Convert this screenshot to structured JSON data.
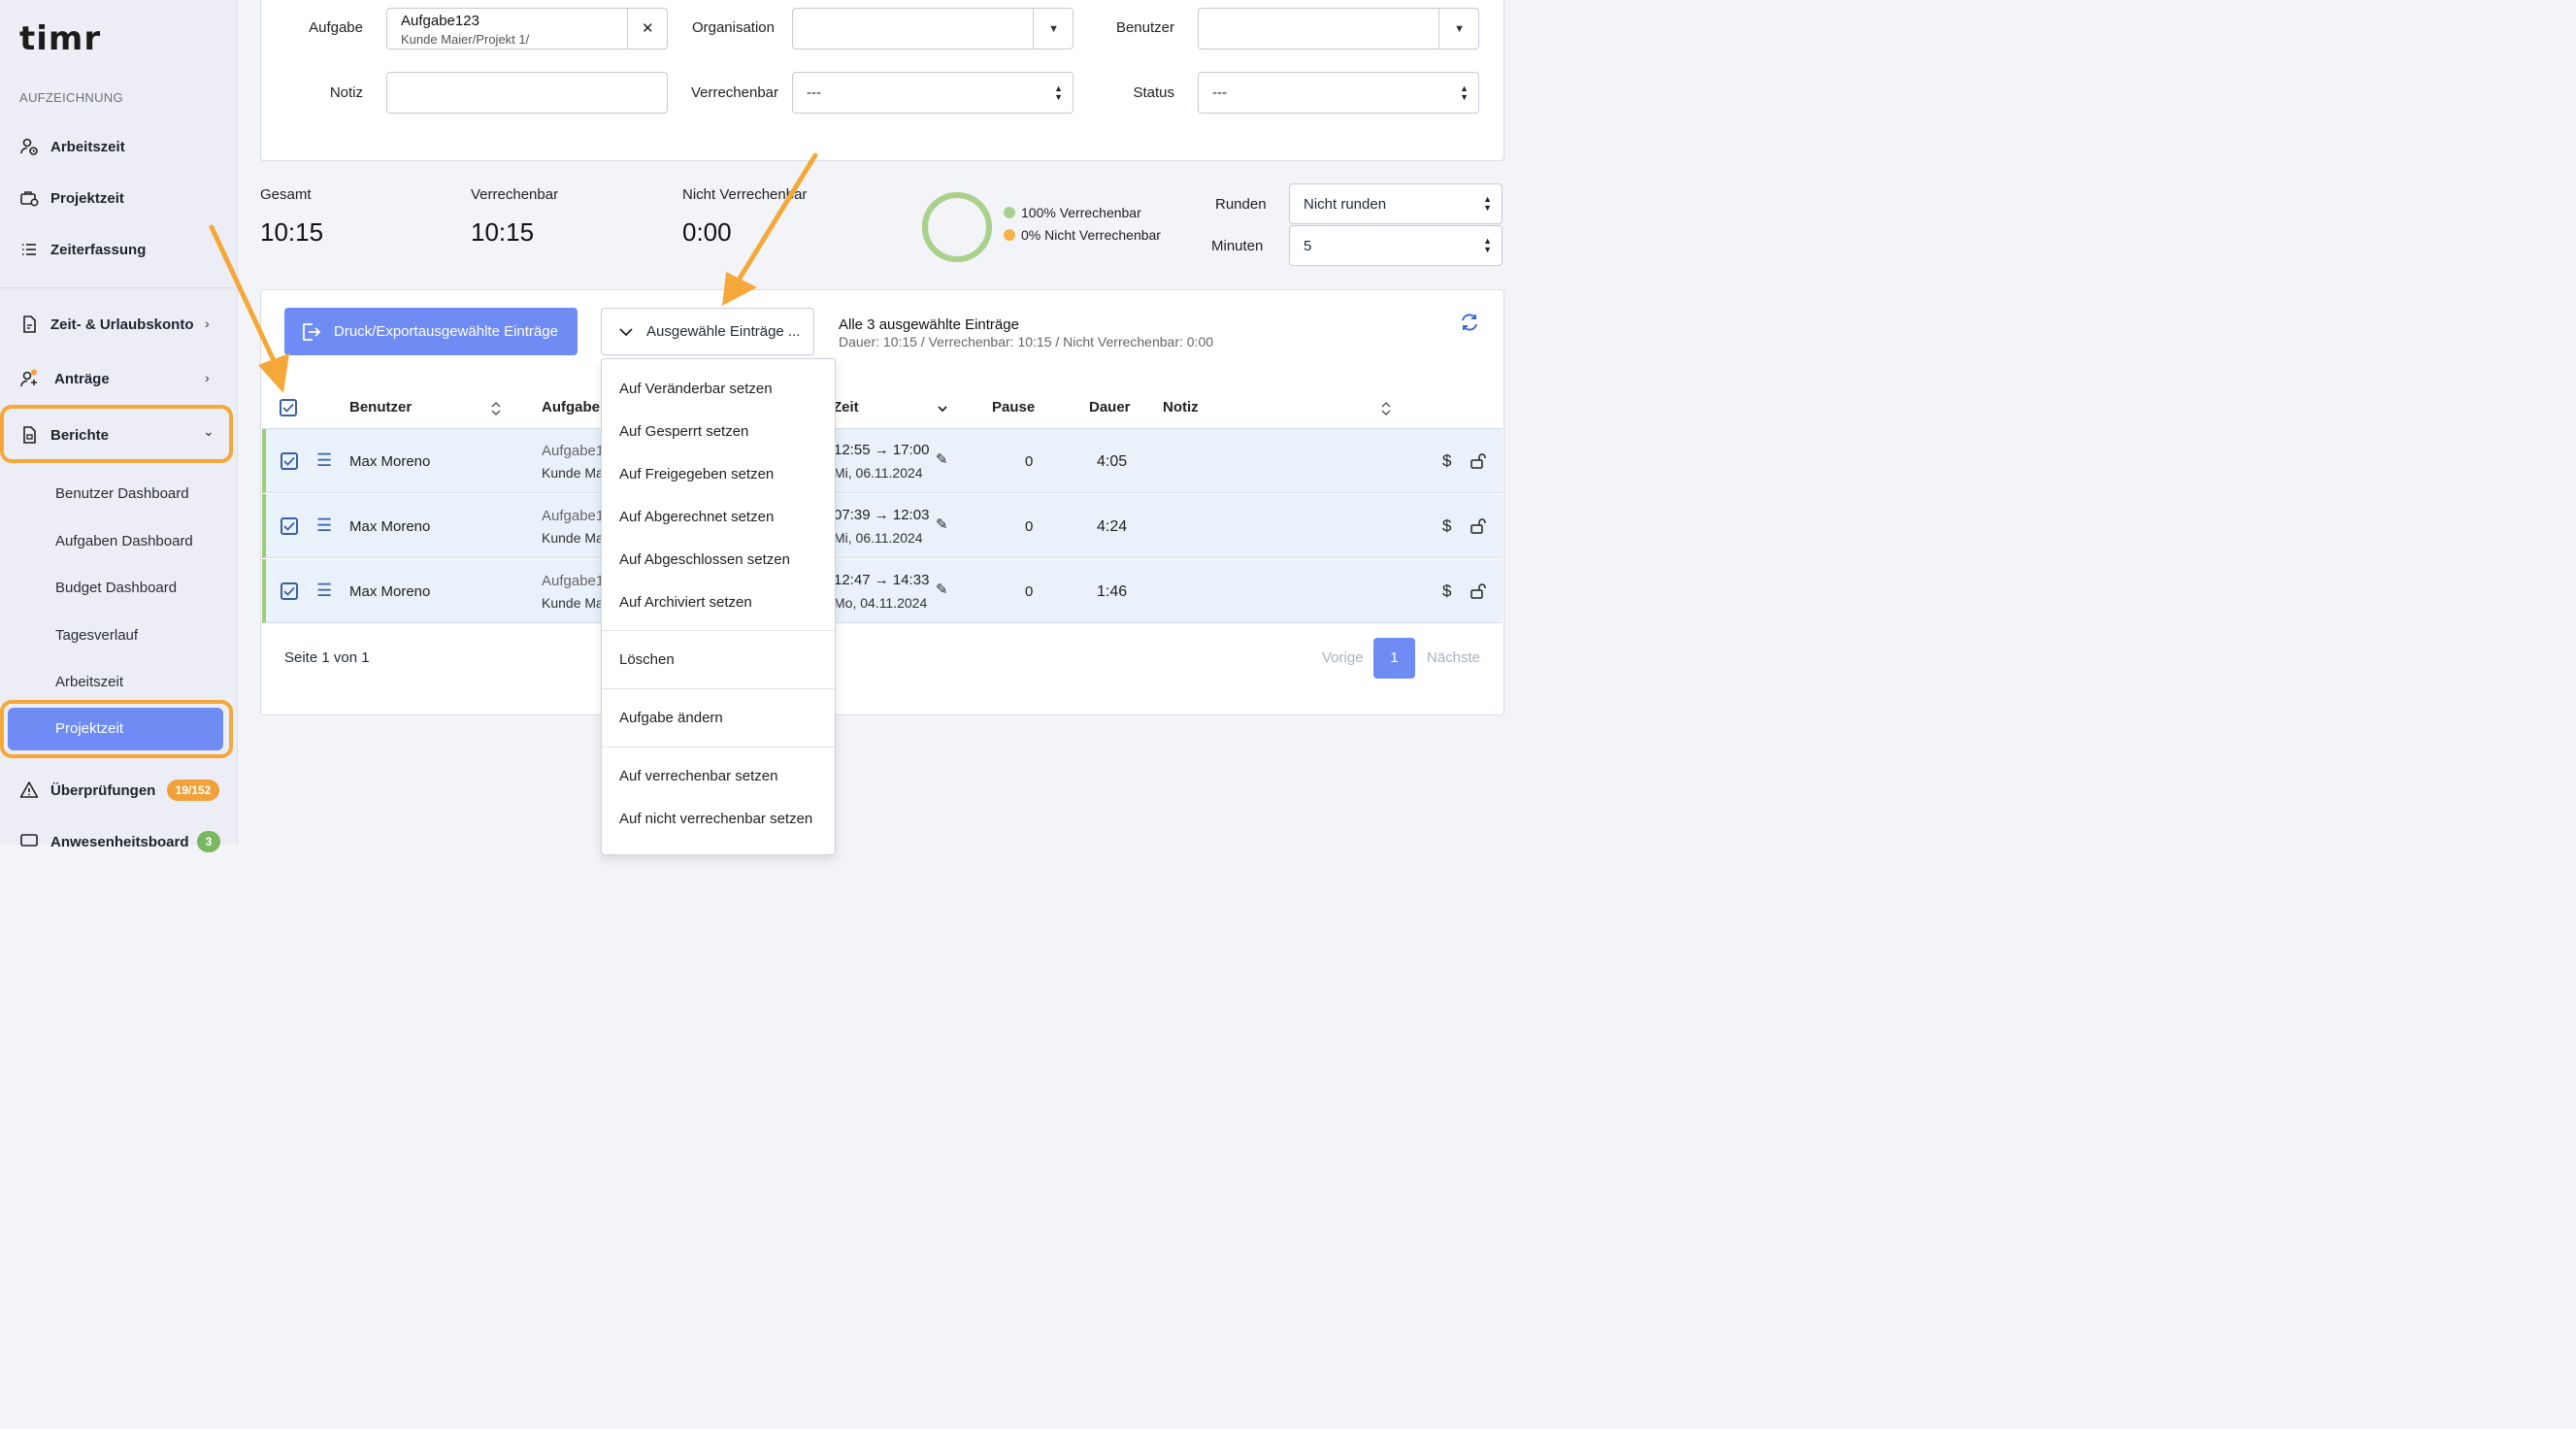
{
  "sidebar": {
    "logo": "timr",
    "section_label": "AUFZEICHNUNG",
    "items": [
      {
        "label": "Arbeitszeit"
      },
      {
        "label": "Projektzeit"
      },
      {
        "label": "Zeiterfassung"
      },
      {
        "label": "Zeit- & Urlaubskonto",
        "chevron": "›"
      },
      {
        "label": "Anträge",
        "chevron": "›"
      },
      {
        "label": "Berichte",
        "chevron": "⌄"
      }
    ],
    "sub_items": [
      {
        "label": "Benutzer Dashboard"
      },
      {
        "label": "Aufgaben Dashboard"
      },
      {
        "label": "Budget Dashboard"
      },
      {
        "label": "Tagesverlauf"
      },
      {
        "label": "Arbeitszeit"
      },
      {
        "label": "Projektzeit"
      }
    ],
    "bottom_items": [
      {
        "label": "Überprüfungen",
        "badge": "19/152"
      },
      {
        "label": "Anwesenheitsboard",
        "badge": "3"
      }
    ],
    "colors": {
      "badge_orange": "#f0a23a",
      "badge_green": "#7bb661",
      "active": "#6f8cf5",
      "highlight": "#f5a83a"
    }
  },
  "filters": {
    "aufgabe_label": "Aufgabe",
    "aufgabe_value": "Aufgabe123",
    "aufgabe_sub": "Kunde Maier/Projekt 1/",
    "clear": "✕",
    "organisation_label": "Organisation",
    "benutzer_label": "Benutzer",
    "notiz_label": "Notiz",
    "verrechenbar_label": "Verrechenbar",
    "verrechenbar_value": "---",
    "status_label": "Status",
    "status_value": "---"
  },
  "stats": {
    "gesamt_label": "Gesamt",
    "gesamt_value": "10:15",
    "verrechenbar_label": "Verrechenbar",
    "verrechenbar_value": "10:15",
    "nicht_label": "Nicht Verrechenbar",
    "nicht_value": "0:00",
    "legend_green": "100% Verrechenbar",
    "legend_orange": "0% Nicht Verrechenbar",
    "billable_fraction": 1.0,
    "runden_label": "Runden",
    "runden_value": "Nicht runden",
    "minuten_label": "Minuten",
    "minuten_value": "5",
    "colors": {
      "green": "#a9d18e",
      "orange": "#f6b24b"
    }
  },
  "toolbar": {
    "export_label": "Druck/Exportausgewählte Einträge",
    "dropdown_label": "Ausgewähle Einträge ...",
    "summary_title": "Alle 3 ausgewählte Einträge",
    "summary_detail": "Dauer: 10:15 / Verrechenbar: 10:15 / Nicht Verrechenbar: 0:00"
  },
  "table": {
    "headers": {
      "benutzer": "Benutzer",
      "aufgabe": "Aufgabe",
      "zeit": "Zeit",
      "pause": "Pause",
      "dauer": "Dauer",
      "notiz": "Notiz"
    },
    "rows": [
      {
        "user": "Max Moreno",
        "task": "Aufgabe123",
        "task_sub": "Kunde Maier/Projekt 1/",
        "time": "12:55 → 17:00",
        "date": "Mi, 06.11.2024",
        "pause": "0",
        "dauer": "4:05"
      },
      {
        "user": "Max Moreno",
        "task": "Aufgabe123",
        "task_sub": "Kunde Maier/Projekt 1/",
        "time": "07:39 → 12:03",
        "date": "Mi, 06.11.2024",
        "pause": "0",
        "dauer": "4:24"
      },
      {
        "user": "Max Moreno",
        "task": "Aufgabe123",
        "task_sub": "Kunde Maier/Projekt 1/",
        "time": "12:47 → 14:33",
        "date": "Mo, 04.11.2024",
        "pause": "0",
        "dauer": "1:46"
      }
    ],
    "pagination": {
      "info": "Seite 1 von 1",
      "prev": "Vorige",
      "page": "1",
      "next": "Nächste"
    }
  },
  "menu": {
    "items": [
      "Auf Veränderbar setzen",
      "Auf Gesperrt setzen",
      "Auf Freigegeben setzen",
      "Auf Abgerechnet setzen",
      "Auf Abgeschlossen setzen",
      "Auf Archiviert setzen",
      "Löschen",
      "Aufgabe ändern",
      "Auf verrechenbar setzen",
      "Auf nicht verrechenbar setzen"
    ]
  }
}
